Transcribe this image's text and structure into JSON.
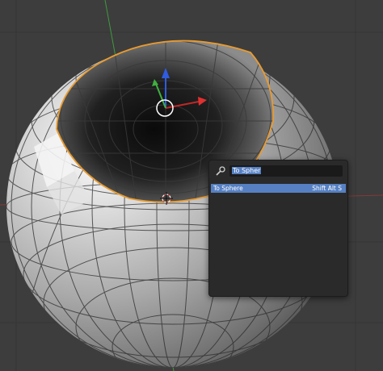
{
  "search": {
    "query": "To Spher",
    "icon": "search-icon"
  },
  "results": [
    {
      "label": "To Sphere",
      "shortcut": "Shift Alt S"
    }
  ],
  "colors": {
    "background": "#3d3d3d",
    "popup": "#2a2a2a",
    "highlight": "#5680c2",
    "selected_edge": "#e89b31",
    "axis_x": "#e03030",
    "axis_y": "#3fb03f",
    "axis_z": "#2f5ce0"
  }
}
